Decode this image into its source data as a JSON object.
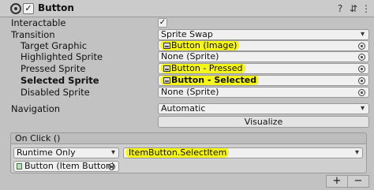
{
  "header": {
    "title": "Button",
    "enabled_mark": "✓",
    "help_glyph": "?",
    "preset_glyph": "⇵",
    "menu_glyph": "⋮"
  },
  "props": {
    "interactable": {
      "label": "Interactable",
      "value": "✓"
    },
    "transition": {
      "label": "Transition",
      "value": "Sprite Swap"
    },
    "target_graphic": {
      "label": "Target Graphic",
      "value": "Button (Image)"
    },
    "highlighted_sprite": {
      "label": "Highlighted Sprite",
      "value": "None (Sprite)"
    },
    "pressed_sprite": {
      "label": "Pressed Sprite",
      "value": "Button - Pressed"
    },
    "selected_sprite": {
      "label": "Selected Sprite",
      "value": "Button - Selected"
    },
    "disabled_sprite": {
      "label": "Disabled Sprite",
      "value": "None (Sprite)"
    },
    "navigation": {
      "label": "Navigation",
      "value": "Automatic"
    },
    "visualize_label": "Visualize"
  },
  "on_click": {
    "header": "On Click ()",
    "runtime": "Runtime Only",
    "function": "ItemButton.SelectItem",
    "object": "Button (Item Button)",
    "add_label": "+",
    "remove_label": "−"
  },
  "colors": {
    "highlight": "#f7f717",
    "panel_bg": "#c2c2c2"
  },
  "icons": [
    "component-icon",
    "enabled-checkbox",
    "help-icon",
    "preset-icon",
    "menu-icon",
    "sprite-icon",
    "object-picker-icon",
    "gameobject-icon"
  ]
}
